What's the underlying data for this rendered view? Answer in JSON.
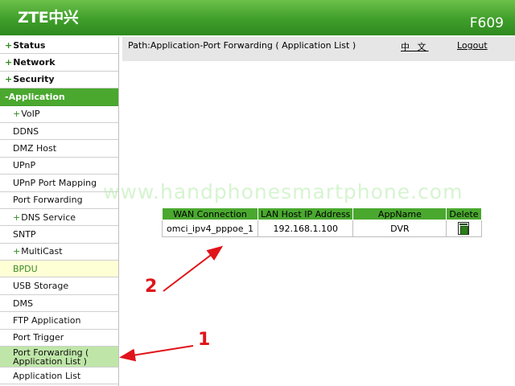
{
  "header": {
    "logo": "ZTE中兴",
    "model": "F609",
    "background_color": "#3f9e2a"
  },
  "sidebar": {
    "items": [
      {
        "label": "Status",
        "prefix": "+",
        "level": "top"
      },
      {
        "label": "Network",
        "prefix": "+",
        "level": "top"
      },
      {
        "label": "Security",
        "prefix": "+",
        "level": "top"
      },
      {
        "label": "Application",
        "prefix": "-",
        "level": "top",
        "state": "expanded"
      },
      {
        "label": "VoIP",
        "prefix": "+",
        "level": "sub"
      },
      {
        "label": "DDNS",
        "prefix": "",
        "level": "sub"
      },
      {
        "label": "DMZ Host",
        "prefix": "",
        "level": "sub"
      },
      {
        "label": "UPnP",
        "prefix": "",
        "level": "sub"
      },
      {
        "label": "UPnP Port Mapping",
        "prefix": "",
        "level": "sub"
      },
      {
        "label": "Port Forwarding",
        "prefix": "",
        "level": "sub"
      },
      {
        "label": "DNS Service",
        "prefix": "+",
        "level": "sub"
      },
      {
        "label": "SNTP",
        "prefix": "",
        "level": "sub"
      },
      {
        "label": "MultiCast",
        "prefix": "+",
        "level": "sub"
      },
      {
        "label": "BPDU",
        "prefix": "",
        "level": "sub",
        "state": "highlight"
      },
      {
        "label": "USB Storage",
        "prefix": "",
        "level": "sub"
      },
      {
        "label": "DMS",
        "prefix": "",
        "level": "sub"
      },
      {
        "label": "FTP Application",
        "prefix": "",
        "level": "sub"
      },
      {
        "label": "Port Trigger",
        "prefix": "",
        "level": "sub"
      },
      {
        "label": "Port Forwarding ( Application List )",
        "line1": "Port Forwarding (",
        "line2": "Application List )",
        "prefix": "",
        "level": "sub",
        "state": "active"
      },
      {
        "label": "Application List",
        "prefix": "",
        "level": "sub"
      }
    ],
    "active_color": "#bfe6a8",
    "expanded_color": "#4aa82f"
  },
  "path_bar": {
    "path": "Path:Application-Port Forwarding ( Application List )",
    "language_link": "中 文",
    "logout_link": "Logout"
  },
  "watermark": "www.handphonesmartphone.com",
  "table": {
    "headers": [
      "WAN Connection",
      "LAN Host IP Address",
      "AppName",
      "Delete"
    ],
    "rows": [
      {
        "wan_connection": "omci_ipv4_pppoe_1",
        "lan_host_ip": "192.168.1.100",
        "app_name": "DVR",
        "delete_icon": "trash-icon"
      }
    ],
    "header_color": "#4aa82f"
  },
  "annotations": {
    "label_1": "1",
    "label_2": "2",
    "color": "#e0141a"
  }
}
